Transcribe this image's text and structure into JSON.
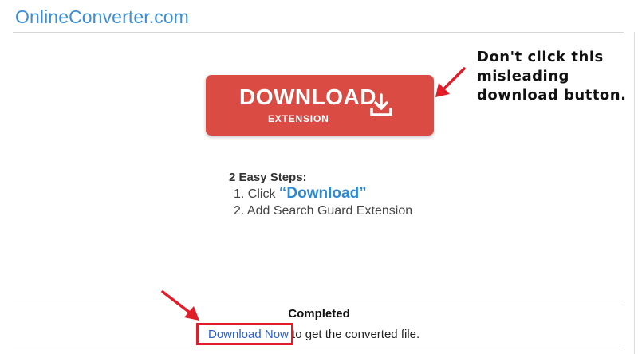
{
  "site": {
    "title": "OnlineConverter.com"
  },
  "ad_button": {
    "main_label": "DOWNLOAD",
    "sub_label": "EXTENSION",
    "icon": "download-icon",
    "color": "#d94b43"
  },
  "annotation": {
    "lines": [
      "Don't click this",
      "misleading",
      "download button."
    ]
  },
  "steps": {
    "title": "2 Easy Steps:",
    "items": [
      {
        "prefix": "1. Click ",
        "highlight": "“Download”"
      },
      {
        "prefix": "2. Add Search Guard Extension",
        "highlight": ""
      }
    ]
  },
  "result": {
    "status": "Completed",
    "link_text": "Download Now",
    "suffix": " to get the converted file."
  },
  "colors": {
    "brand": "#3a8fd6",
    "link": "#2a5fd0",
    "highlight_box": "#e01e2a",
    "arrow": "#e01e2a"
  }
}
